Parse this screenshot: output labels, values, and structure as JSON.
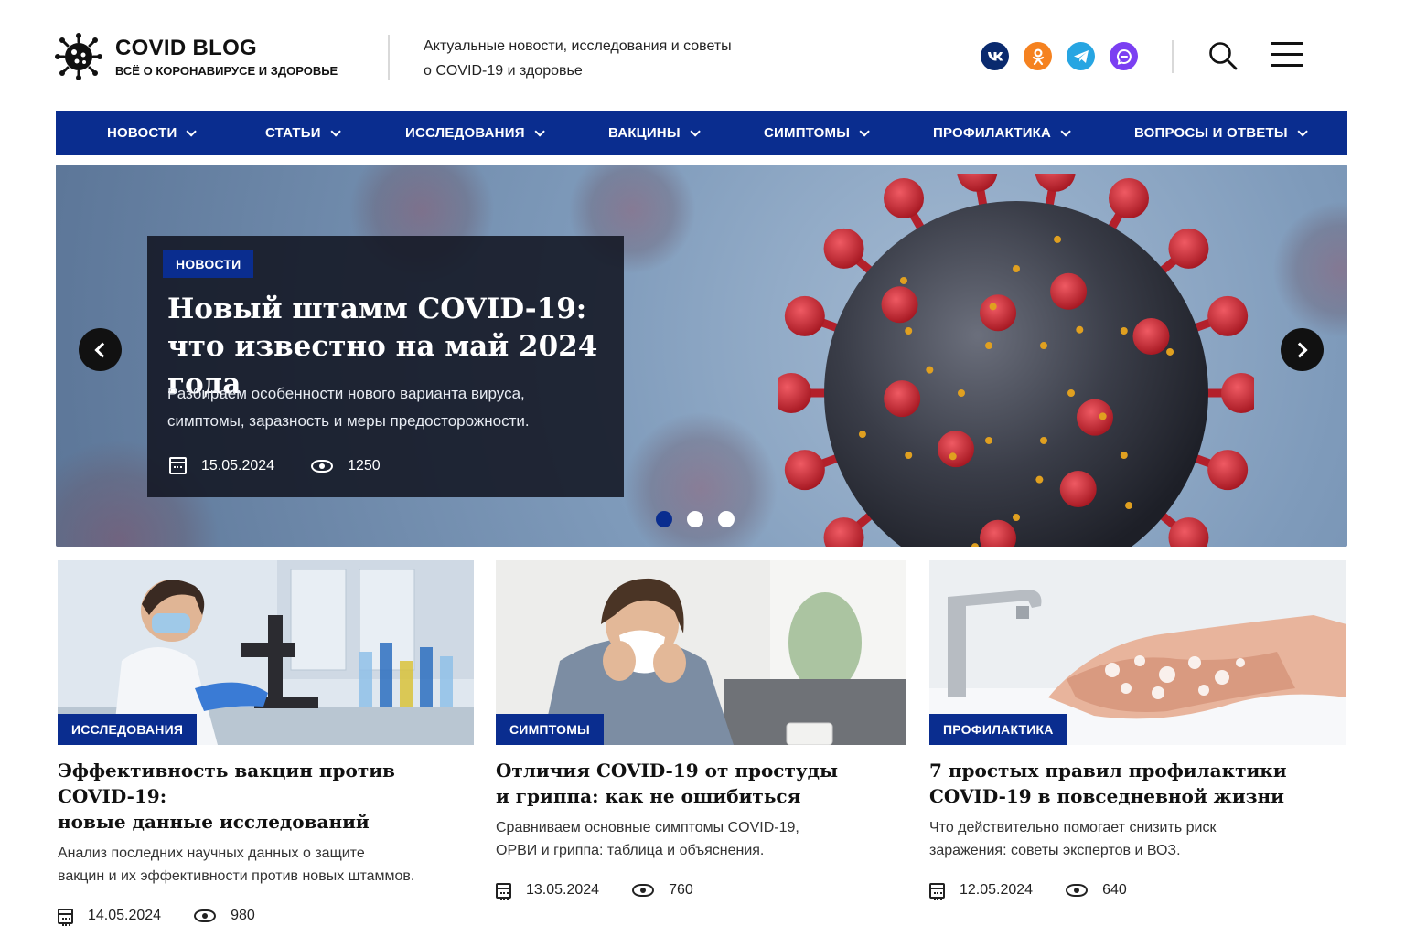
{
  "header": {
    "logo_title": "COVID BLOG",
    "logo_subtitle": "ВСЁ О КОРОНАВИРУСЕ И ЗДОРОВЬЕ",
    "tagline_line1": "Актуальные новости, исследования и советы",
    "tagline_line2": "о COVID-19 и здоровье",
    "socials": [
      {
        "icon": "vk-icon",
        "glyph": "VK",
        "color": "#0a2a6e"
      },
      {
        "icon": "odnoklassniki-icon",
        "glyph": "OK",
        "color": "#f58220"
      },
      {
        "icon": "telegram-icon",
        "glyph": "➤",
        "color": "#27a5e2"
      },
      {
        "icon": "viber-icon",
        "glyph": "☏",
        "color": "#7b3ff2"
      }
    ]
  },
  "nav": {
    "items": [
      {
        "label": "НОВОСТИ"
      },
      {
        "label": "СТАТЬИ"
      },
      {
        "label": "ИССЛЕДОВАНИЯ"
      },
      {
        "label": "ВАКЦИНЫ"
      },
      {
        "label": "СИМПТОМЫ"
      },
      {
        "label": "ПРОФИЛАКТИКА"
      },
      {
        "label": "ВОПРОСЫ И ОТВЕТЫ"
      }
    ]
  },
  "hero": {
    "badge": "НОВОСТИ",
    "title_line1": "Новый штамм COVID-19:",
    "title_line2": "что известно на май 2024 года",
    "desc_line1": "Разбираем особенности нового варианта вируса,",
    "desc_line2": "симптомы, заразность и меры предосторожности.",
    "date": "15.05.2024",
    "views": "1250",
    "slides_count": 3,
    "active_slide": 1
  },
  "cards": [
    {
      "badge": "ИССЛЕДОВАНИЯ",
      "title_line1": "Эффективность вакцин против COVID-19:",
      "title_line2": "новые данные исследований",
      "desc_line1": "Анализ последних научных данных о защите",
      "desc_line2": "вакцин и их эффективности против новых штаммов.",
      "date": "14.05.2024",
      "views": "980"
    },
    {
      "badge": "СИМПТОМЫ",
      "title_line1": "Отличия COVID-19 от простуды",
      "title_line2": "и гриппа: как не ошибиться",
      "desc_line1": "Сравниваем основные симптомы COVID-19,",
      "desc_line2": "ОРВИ и гриппа: таблица и объяснения.",
      "date": "13.05.2024",
      "views": "760"
    },
    {
      "badge": "ПРОФИЛАКТИКА",
      "title_line1": "7 простых правил профилактики",
      "title_line2": "COVID-19 в повседневной жизни",
      "desc_line1": "Что действительно помогает снизить риск",
      "desc_line2": "заражения: советы экспертов и ВОЗ.",
      "date": "12.05.2024",
      "views": "640"
    }
  ],
  "colors": {
    "brand_blue": "#0a2d8f",
    "hero_panel": "#121622"
  }
}
